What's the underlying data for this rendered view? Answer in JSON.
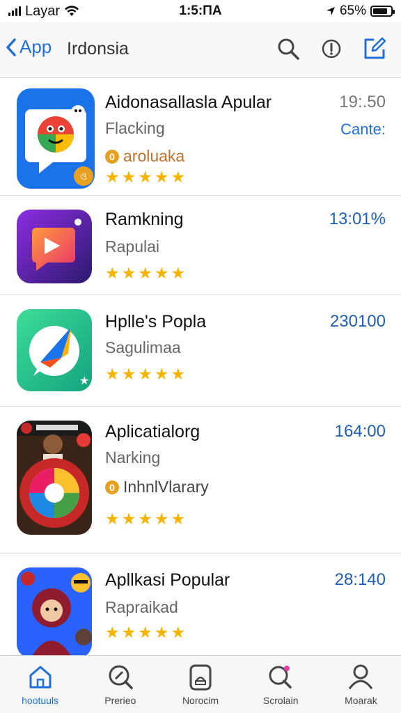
{
  "status_bar": {
    "carrier": "Layar",
    "time": "1:5:ΠA",
    "battery_percent": "65%",
    "battery_level": 0.85
  },
  "nav": {
    "back_label": "App",
    "title": "Irdonsia",
    "icons": [
      "search-icon",
      "info-icon",
      "compose-icon"
    ]
  },
  "apps": [
    {
      "name": "Aidonasallasla Apular",
      "subtitle": "Flacking",
      "extra": "arolu­aka",
      "value": "19:.50",
      "value_sub": "Cante:",
      "rating": 5,
      "icon": "chat-face-icon"
    },
    {
      "name": "Ramkning",
      "subtitle": "Rapulai",
      "value": "13:01%",
      "rating": 5,
      "icon": "play-chat-icon"
    },
    {
      "name": "Hplle's Popla",
      "subtitle": "Sagulimaa",
      "value": "230100",
      "rating": 5,
      "icon": "arrow-chat-icon"
    },
    {
      "name": "Aplicatialorg",
      "subtitle": "Narking",
      "extra": "InhnlVlarary",
      "value": "164:00",
      "rating": 5,
      "icon": "game-swirl-icon"
    },
    {
      "name": "Apllkasi Popular",
      "subtitle": "Rapraikad",
      "value": "28:140",
      "rating": 5,
      "icon": "game-character-icon"
    }
  ],
  "tabs": [
    {
      "label": "hootuuls",
      "icon": "home-icon",
      "active": true
    },
    {
      "label": "Prerieo",
      "icon": "search-icon",
      "active": false
    },
    {
      "label": "Norocim",
      "icon": "tablet-icon",
      "active": false
    },
    {
      "label": "Scrolain",
      "icon": "search-badge-icon",
      "active": false
    },
    {
      "label": "Moarak",
      "icon": "person-icon",
      "active": false
    }
  ],
  "colors": {
    "accent": "#1e6fd9",
    "star": "#f5b400",
    "value_blue": "#1e5fb8"
  }
}
